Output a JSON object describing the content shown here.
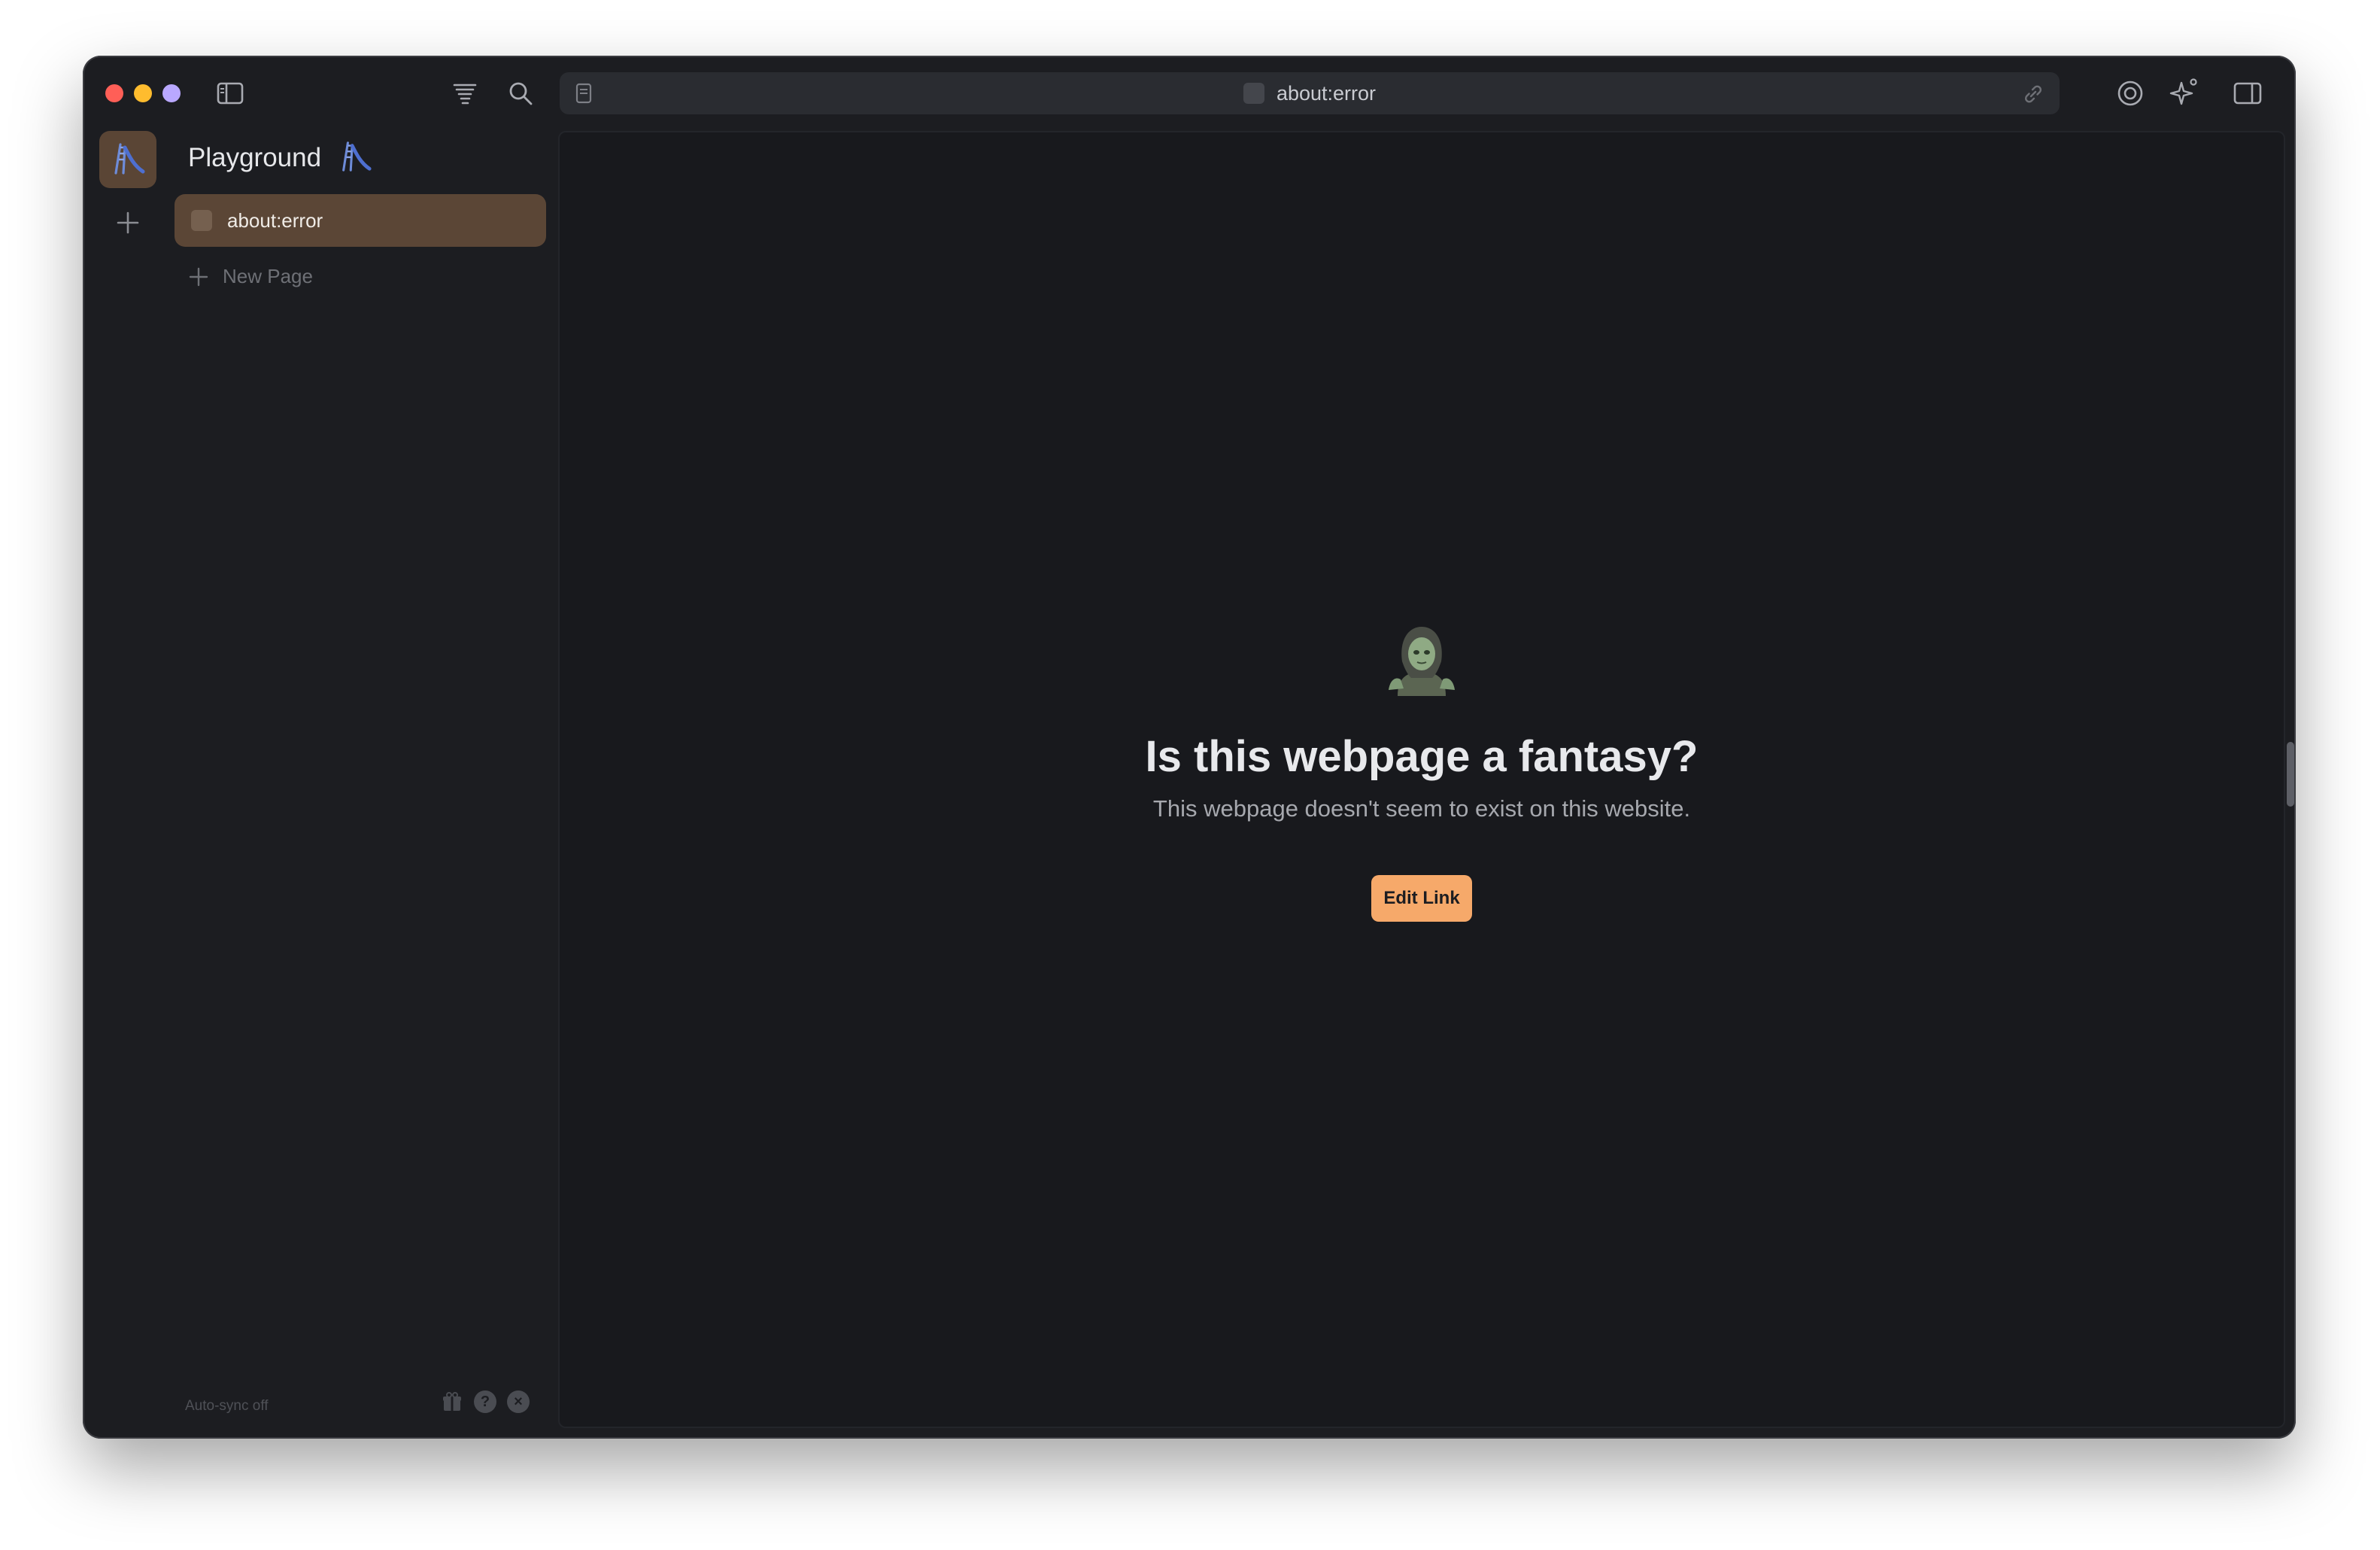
{
  "window": {
    "traffic_colors": {
      "close": "#ff5f57",
      "minimize": "#febc2e",
      "zoom": "#b9a8ff"
    }
  },
  "toolbar": {
    "icons": [
      "sidebar-toggle-icon",
      "tornado-icon",
      "search-icon",
      "reader-icon",
      "link-icon",
      "record-icon",
      "sparkle-icon",
      "right-panel-icon"
    ]
  },
  "address_bar": {
    "url": "about:error"
  },
  "sidebar": {
    "title": "Playground",
    "title_icon": "slide-icon",
    "pages": [
      {
        "label": "about:error",
        "selected": true
      }
    ],
    "new_page_label": "New Page",
    "footer": {
      "sync_status": "Auto-sync off",
      "icons": [
        "gift-icon",
        "help-icon",
        "close-circle-icon"
      ]
    }
  },
  "error_page": {
    "emoji": "zombie-icon",
    "headline": "Is this webpage a fantasy?",
    "message": "This webpage doesn't seem to exist on this website.",
    "button_label": "Edit Link"
  },
  "colors": {
    "accent": "#f6a96a",
    "selected_row": "#5b4636",
    "background": "#18191d"
  }
}
